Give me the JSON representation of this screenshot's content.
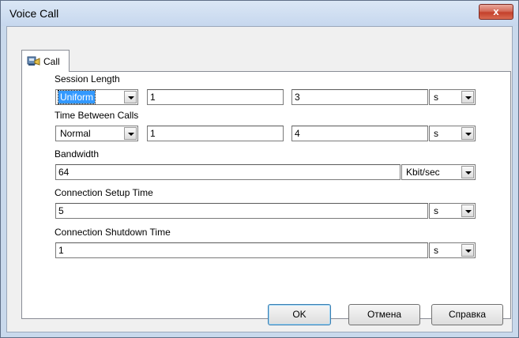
{
  "window": {
    "title": "Voice Call",
    "close_glyph": "x"
  },
  "tab": {
    "label": "Call",
    "icon": "phone-call-icon"
  },
  "session_length": {
    "label": "Session Length",
    "distribution": "Uniform",
    "param1": "1",
    "param2": "3",
    "unit": "s"
  },
  "time_between_calls": {
    "label": "Time Between Calls",
    "distribution": "Normal",
    "param1": "1",
    "param2": "4",
    "unit": "s"
  },
  "bandwidth": {
    "label": "Bandwidth",
    "value": "64",
    "unit": "Kbit/sec"
  },
  "connection_setup": {
    "label": "Connection Setup Time",
    "value": "5",
    "unit": "s"
  },
  "connection_shutdown": {
    "label": "Connection Shutdown Time",
    "value": "1",
    "unit": "s"
  },
  "buttons": {
    "ok": "OK",
    "cancel": "Отмена",
    "help": "Справка"
  }
}
